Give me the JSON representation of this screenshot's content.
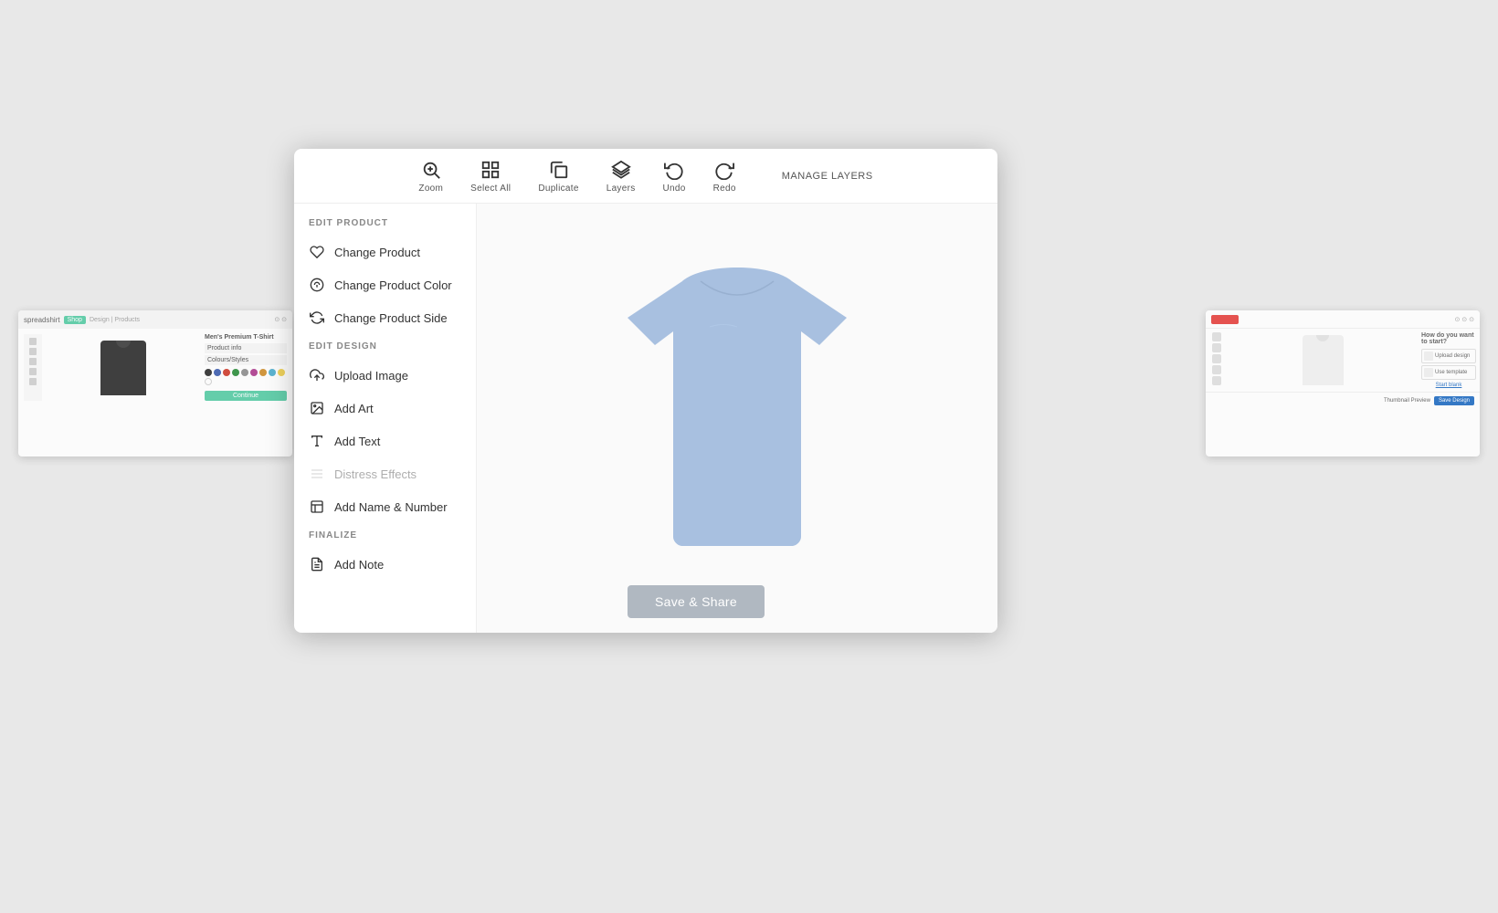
{
  "toolbar": {
    "items": [
      {
        "id": "zoom",
        "label": "Zoom",
        "icon": "🔍"
      },
      {
        "id": "select-all",
        "label": "Select All",
        "icon": "⊞"
      },
      {
        "id": "duplicate",
        "label": "Duplicate",
        "icon": "❏"
      },
      {
        "id": "layers",
        "label": "Layers",
        "icon": "◈"
      },
      {
        "id": "undo",
        "label": "Undo",
        "icon": "↩"
      },
      {
        "id": "redo",
        "label": "Redo",
        "icon": "↪"
      }
    ],
    "manage_layers_label": "MANAGE LAYERS"
  },
  "left_panel": {
    "edit_product_label": "EDIT PRODUCT",
    "edit_design_label": "EDIT DESIGN",
    "finalize_label": "FINALIZE",
    "menu_items": {
      "change_product": "Change Product",
      "change_product_color": "Change Product Color",
      "change_product_side": "Change Product Side",
      "upload_image": "Upload Image",
      "add_art": "Add Art",
      "add_text": "Add Text",
      "distress_effects": "Distress Effects",
      "add_name_number": "Add Name & Number",
      "add_note": "Add Note"
    }
  },
  "center": {
    "tshirt_color": "#a8c0e0",
    "save_share_label": "Save & Share"
  }
}
